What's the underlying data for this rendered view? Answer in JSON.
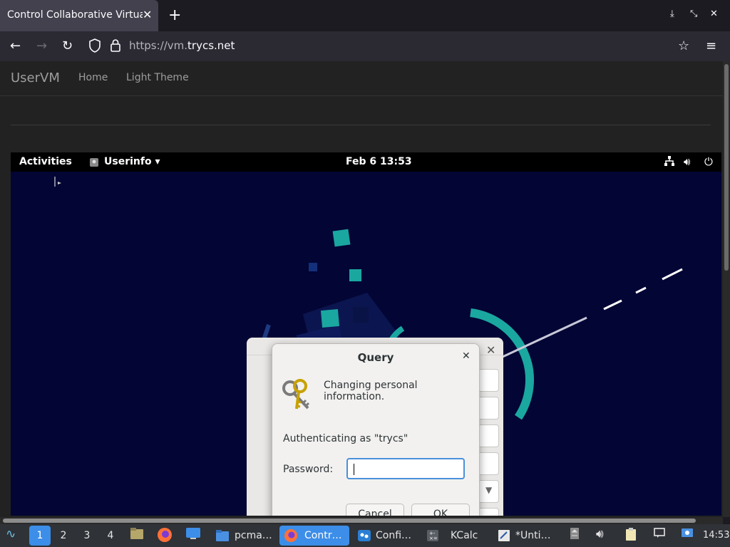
{
  "browser": {
    "tab_title": "Control Collaborative Virtual",
    "tab_close": "✕",
    "new_tab": "+",
    "url_scheme": "https://vm.",
    "url_host": "trycs.net"
  },
  "site": {
    "brand": "UserVM",
    "nav": [
      "Home",
      "Light Theme"
    ]
  },
  "vm_topbar": {
    "activities": "Activities",
    "app_menu": "Userinfo ▾",
    "clock": "Feb 6  13:53"
  },
  "query_dialog": {
    "title": "Query",
    "close": "✕",
    "message": "Changing personal information.",
    "auth_as": "Authenticating as \"trycs\"",
    "password_label": "Password:",
    "password_value": "",
    "cancel": "Cancel",
    "ok": "OK"
  },
  "back_dialog": {
    "close": "✕"
  },
  "taskbar": {
    "desktops": [
      "1",
      "2",
      "3",
      "4"
    ],
    "active_desktop": "1",
    "tasks": [
      {
        "label": "pcma…",
        "icon": "folder-icon"
      },
      {
        "label": "Contr…",
        "icon": "firefox-icon",
        "active": true
      },
      {
        "label": "Confi…",
        "icon": "settings-icon"
      },
      {
        "label": "KCalc",
        "icon": "calculator-icon"
      },
      {
        "label": "*Unti…",
        "icon": "text-editor-icon"
      }
    ],
    "time": "14:53"
  },
  "colors": {
    "accent": "#3d8ee8",
    "vm_background": "#030535",
    "teal": "#1aa7a0"
  }
}
